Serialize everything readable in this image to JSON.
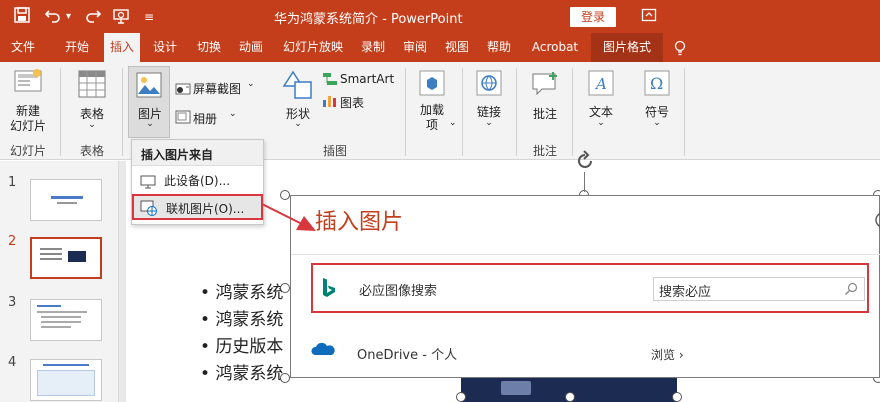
{
  "window": {
    "title": "华为鸿蒙系统简介  -  PowerPoint",
    "login_label": "登录"
  },
  "tabs": [
    {
      "label": "文件"
    },
    {
      "label": "开始"
    },
    {
      "label": "插入"
    },
    {
      "label": "设计"
    },
    {
      "label": "切换"
    },
    {
      "label": "动画"
    },
    {
      "label": "幻灯片放映"
    },
    {
      "label": "录制"
    },
    {
      "label": "审阅"
    },
    {
      "label": "视图"
    },
    {
      "label": "帮助"
    },
    {
      "label": "Acrobat"
    },
    {
      "label": "图片格式"
    }
  ],
  "ribbon": {
    "new_slide": "新建\n幻灯片",
    "group_slides": "幻灯片",
    "table": "表格",
    "group_table": "表格",
    "picture": "图片",
    "screenshot": "屏幕截图",
    "album": "相册",
    "shapes": "形状",
    "smartart": "SmartArt",
    "chart": "图表",
    "group_illustrations": "插图",
    "addins": "加载\n项",
    "link": "链接",
    "comment": "批注",
    "group_comments": "批注",
    "text": "文本",
    "symbols": "符号"
  },
  "dropdown": {
    "header": "插入图片来自",
    "this_device": "此设备(D)...",
    "online_pictures": "联机图片(O)..."
  },
  "slides": [
    {
      "number": "1"
    },
    {
      "number": "2"
    },
    {
      "number": "3"
    },
    {
      "number": "4"
    }
  ],
  "canvas": {
    "bullets": [
      "鸿蒙系统",
      "鸿蒙系统",
      "历史版本",
      "鸿蒙系统"
    ]
  },
  "dialog": {
    "title": "插入图片",
    "bing_label": "必应图像搜索",
    "search_placeholder": "搜索必应",
    "onedrive_label": "OneDrive - 个人",
    "browse_label": "浏览"
  },
  "colors": {
    "accent": "#c43e1c",
    "highlight_box": "#d9363e"
  }
}
